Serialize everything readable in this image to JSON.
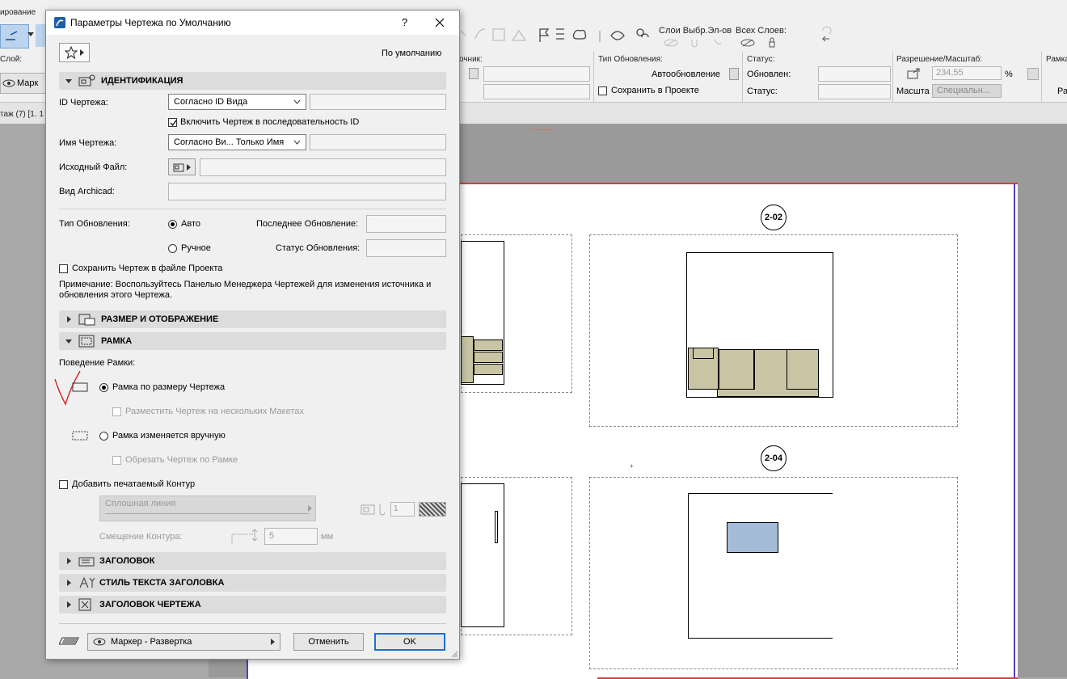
{
  "app": {
    "menu_partial": "ирование",
    "layer_label": "Слой:",
    "layer_value": "Марк",
    "source_label": "очник:",
    "update_type_label": "Тип Обновления:",
    "auto_update": "Автообновление",
    "save_in_project": "Сохранить в Проекте",
    "status_label": "Статус:",
    "updated_label": "Обновлен:",
    "status2_label": "Статус:",
    "layers_sel": "Слои Выбр.Эл-ов",
    "all_layers": "Всех Слоев:",
    "resolution_label": "Разрешение/Масштаб:",
    "resolution_value": "234,55",
    "percent": "%",
    "scale_label": "Масшта",
    "scale_value": "Специальн...",
    "frame_partial": "Рамка",
    "ra_partial": "Ра",
    "tab_partial": "таж (7) [1. 1",
    "marker_a": "2-02",
    "marker_b": "2-04"
  },
  "dialog": {
    "title": "Параметры Чертежа по Умолчанию",
    "help": "?",
    "default_label": "По умолчанию",
    "sections": {
      "identification": "ИДЕНТИФИКАЦИЯ",
      "size_display": "РАЗМЕР И ОТОБРАЖЕНИЕ",
      "frame": "РАМКА",
      "title": "ЗАГОЛОВОК",
      "title_text_style": "СТИЛЬ ТЕКСТА ЗАГОЛОВКА",
      "drawing_title": "ЗАГОЛОВОК ЧЕРТЕЖА"
    },
    "id_label": "ID Чертежа:",
    "id_combo": "Согласно ID Вида",
    "include_seq": "Включить Чертеж в последовательность ID",
    "name_label": "Имя Чертежа:",
    "name_combo": "Согласно Ви... Только Имя",
    "source_file_label": "Исходный Файл:",
    "archicad_view_label": "Вид Archicad:",
    "update_type_label": "Тип Обновления:",
    "auto": "Авто",
    "manual": "Ручное",
    "last_update_label": "Последнее Обновление:",
    "update_status_label": "Статус Обновления:",
    "save_in_file": "Сохранить Чертеж в файле Проекта",
    "note": "Примечание: Воспользуйтесь Панелью Менеджера Чертежей для изменения источника и обновления этого Чертежа.",
    "frame_behavior": "Поведение Рамки:",
    "frame_fit": "Рамка по размеру Чертежа",
    "place_multi": "Разместить Чертеж на нескольких Макетах",
    "frame_manual": "Рамка изменяется вручную",
    "crop": "Обрезать Чертеж по Рамке",
    "add_contour": "Добавить печатаемый Контур",
    "line_type": "Сплошная линия",
    "pen_value": "1",
    "contour_offset_label": "Смещение Контура:",
    "offset_value": "5",
    "offset_unit": "мм",
    "footer_marker": "Маркер - Развертка",
    "cancel": "Отменить",
    "ok": "OK"
  }
}
